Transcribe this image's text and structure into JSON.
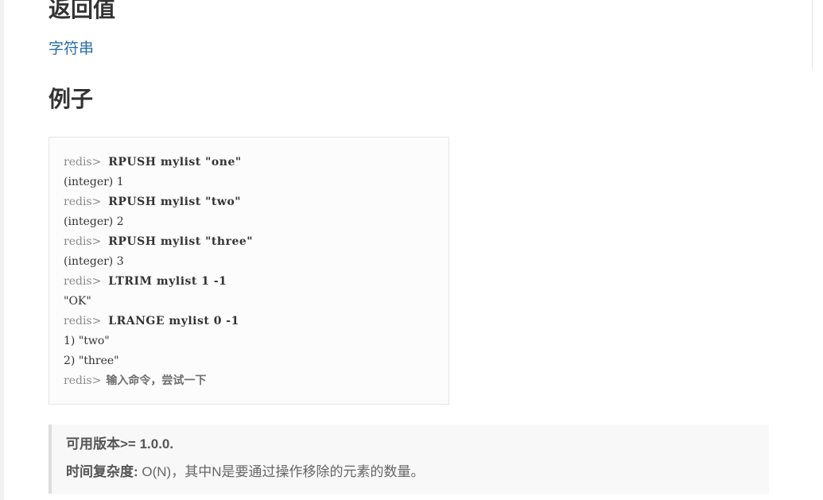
{
  "sections": {
    "return_heading": "返回值",
    "return_value_link": "字符串",
    "example_heading": "例子"
  },
  "console": {
    "lines": [
      {
        "type": "input",
        "prompt": "redis>",
        "text": "RPUSH mylist \"one\""
      },
      {
        "type": "output",
        "text": "(integer) 1"
      },
      {
        "type": "input",
        "prompt": "redis>",
        "text": "RPUSH mylist \"two\""
      },
      {
        "type": "output",
        "text": "(integer) 2"
      },
      {
        "type": "input",
        "prompt": "redis>",
        "text": "RPUSH mylist \"three\""
      },
      {
        "type": "output",
        "text": "(integer) 3"
      },
      {
        "type": "input",
        "prompt": "redis>",
        "text": "LTRIM mylist 1 -1"
      },
      {
        "type": "output",
        "text": "\"OK\""
      },
      {
        "type": "input",
        "prompt": "redis>",
        "text": "LRANGE mylist 0 -1"
      },
      {
        "type": "output",
        "text": "1) \"two\""
      },
      {
        "type": "output",
        "text": "2) \"three\""
      }
    ],
    "input_prompt": "redis>",
    "input_placeholder": "输入命令，尝试一下",
    "input_value": ""
  },
  "info": {
    "version_label": "可用版本>= 1.0.0.",
    "complexity_label": "时间复杂度:",
    "complexity_text": " O(N)，其中N是要通过操作移除的元素的数量。"
  },
  "colors": {
    "link": "#2a6ea6",
    "prompt": "#8a8a8a",
    "text": "#333333"
  }
}
